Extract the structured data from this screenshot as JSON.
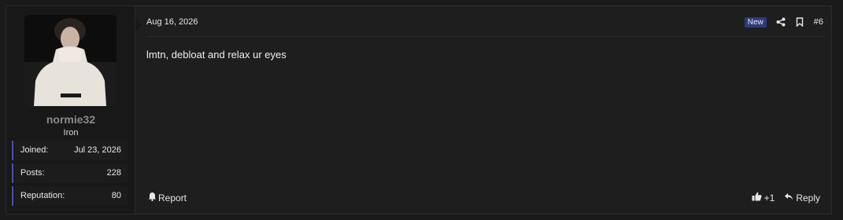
{
  "user": {
    "username": "normie32",
    "title": "Iron",
    "stats": [
      {
        "label": "Joined:",
        "value": "Jul 23, 2026"
      },
      {
        "label": "Posts:",
        "value": "228"
      },
      {
        "label": "Reputation:",
        "value": "80"
      }
    ]
  },
  "post": {
    "date": "Aug 16, 2026",
    "badge": "New",
    "number": "#6",
    "message": "lmtn, debloat and relax ur eyes"
  },
  "footer": {
    "report_label": "Report",
    "reaction_count": "+1",
    "reply_label": "Reply"
  },
  "colors": {
    "accent": "#4b4fa6",
    "badge_bg": "#2d3a7a"
  },
  "icons": [
    "share-icon",
    "bookmark-icon",
    "bell-icon",
    "thumbs-up-icon",
    "reply-icon"
  ]
}
